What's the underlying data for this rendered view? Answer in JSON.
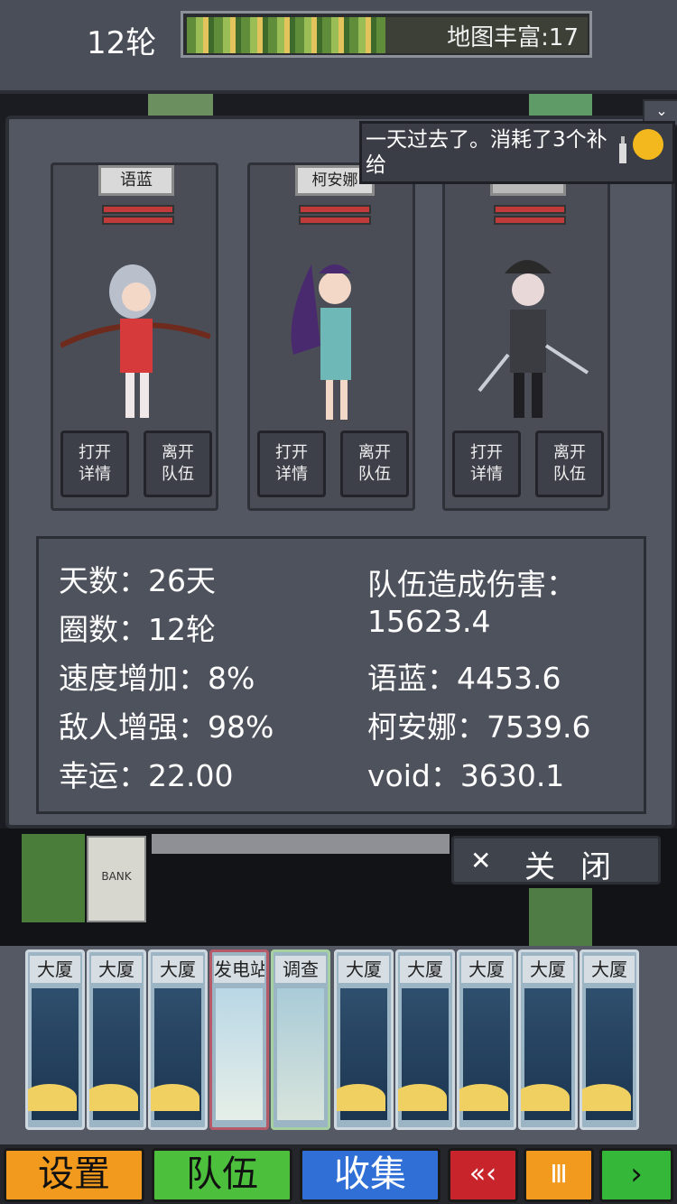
{
  "top_bar": {
    "round": "12轮",
    "map_richness": "地图丰富:17"
  },
  "notification": {
    "message": "一天过去了。消耗了3个补给",
    "collapse_icon": "chevron-down-icon"
  },
  "team": [
    {
      "name": "语蓝",
      "open_details": "打开\n详情",
      "open_1": "打开",
      "open_2": "详情",
      "leave_1": "离开",
      "leave_2": "队伍"
    },
    {
      "name": "柯安娜",
      "open_1": "打开",
      "open_2": "详情",
      "leave_1": "离开",
      "leave_2": "队伍"
    },
    {
      "name": "",
      "open_1": "打开",
      "open_2": "详情",
      "leave_1": "离开",
      "leave_2": "队伍"
    }
  ],
  "stats": {
    "days": "天数：26天",
    "laps": "圈数：12轮",
    "speed": "速度增加：8%",
    "enemy": "敌人增强：98%",
    "luck": "幸运：22.00",
    "team_damage_label": "队伍造成伤害：",
    "team_damage_value": "15623.4",
    "dmg_yulan": "语蓝：4453.6",
    "dmg_keanna": "柯安娜：7539.6",
    "dmg_void": "void：3630.1"
  },
  "close_button": {
    "label": "关闭"
  },
  "world": {
    "bank_sign": "BANK"
  },
  "deck": [
    {
      "label": "大厦",
      "type": "building"
    },
    {
      "label": "大厦",
      "type": "building"
    },
    {
      "label": "大厦",
      "type": "building"
    },
    {
      "label": "发电站",
      "type": "power"
    },
    {
      "label": "调查",
      "type": "investigate"
    },
    {
      "label": "大厦",
      "type": "building"
    },
    {
      "label": "大厦",
      "type": "building"
    },
    {
      "label": "大厦",
      "type": "building"
    },
    {
      "label": "大厦",
      "type": "building"
    },
    {
      "label": "大厦",
      "type": "building"
    }
  ],
  "bottom_bar": {
    "settings": "设置",
    "team": "队伍",
    "collect": "收集",
    "rewind": "«‹",
    "pause": "Ⅲ",
    "play": "›"
  },
  "colors": {
    "settings": "#f29a1d",
    "team": "#4cbf3c",
    "collect": "#2f6fd6",
    "rewind": "#c8242b",
    "pause": "#f29a1d",
    "play": "#35b83a"
  }
}
